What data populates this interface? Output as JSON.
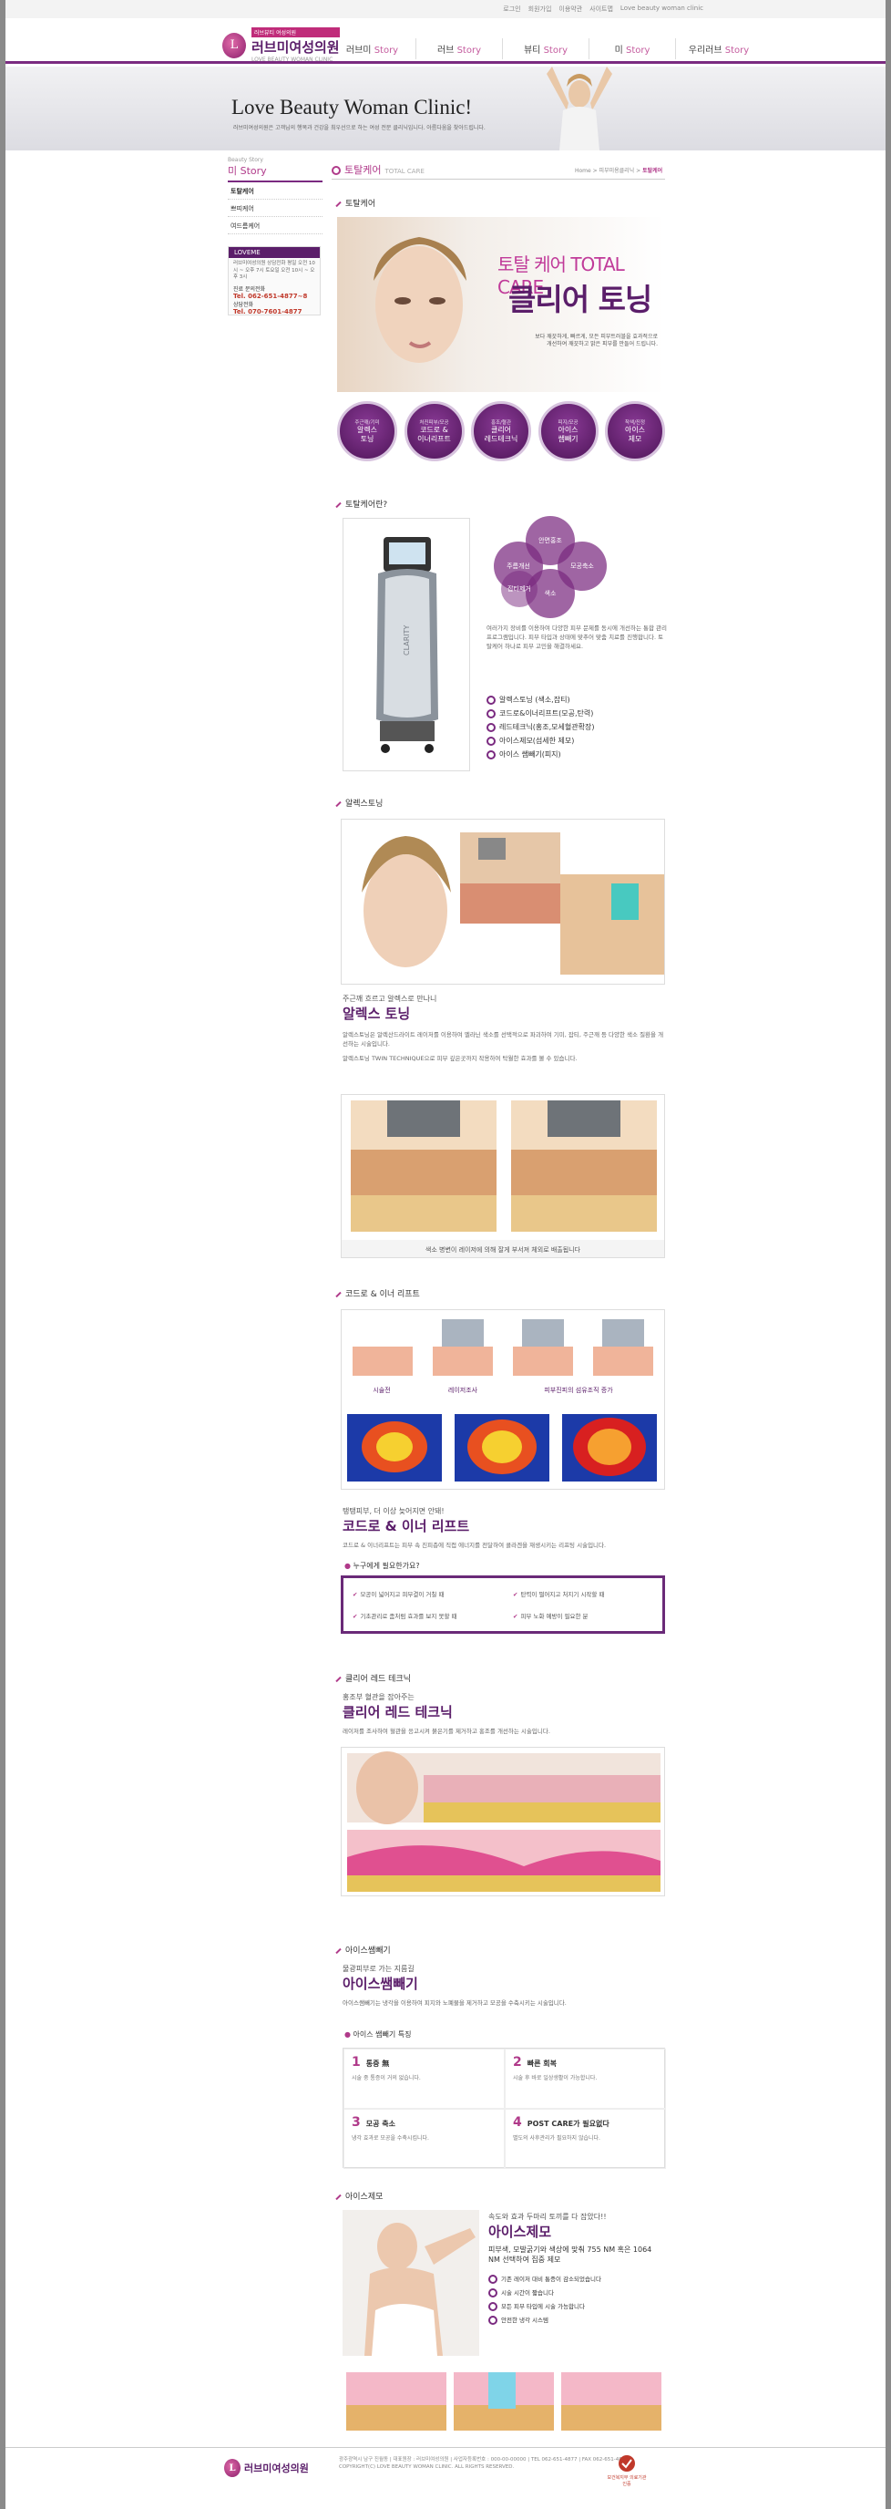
{
  "topbar": {
    "links": [
      "로그인",
      "회원가입",
      "이용약관",
      "사이트맵",
      "Love beauty woman clinic"
    ]
  },
  "header": {
    "logo_tag": "러브뷰티 여성의원",
    "logo_name": "러브미여성의원",
    "logo_en": "LOVE BEAUTY WOMAN CLINIC",
    "nav": [
      {
        "ko": "러브미",
        "en": "Story"
      },
      {
        "ko": "러브",
        "en": "Story"
      },
      {
        "ko": "뷰티",
        "en": "Story"
      },
      {
        "ko": "미",
        "en": "Story"
      },
      {
        "ko": "우리러브",
        "en": "Story"
      }
    ]
  },
  "banner": {
    "title": "Love Beauty Woman Clinic!",
    "subtitle": "러브미여성의원은 고객님의 행복과 건강을 최우선으로 하는 여성 전문 클리닉입니다. 아름다움을 찾아드립니다."
  },
  "sidebar": {
    "top": "Beauty Story",
    "title": "미 Story",
    "items": [
      "토탈케어",
      "쁘띠케어",
      "여드름케어"
    ],
    "cs": {
      "head": "LOVEME",
      "text": "러브미여성의원 상담전화 평일 오전 10시 ~ 오후 7시 토요일 오전 10시 ~ 오후 3시",
      "lbl1": "진료 문의전화",
      "tel1": "Tel. 062-651-4877~8",
      "lbl2": "상담전화",
      "tel2": "Tel. 070-7601-4877"
    }
  },
  "content": {
    "title": "토탈케어",
    "title_en": "TOTAL CARE",
    "breadcrumb_prefix": "Home > 피부미용클리닉 >",
    "breadcrumb_current": "토탈케어",
    "sec1": "토탈케어",
    "hero": {
      "t1": "토탈 케어 TOTAL CARE",
      "t2": "클리어 토닝",
      "desc": "보다 깨끗하게, 빠르게, 모든 피부트러블을 효과적으로 개선하여 깨끗하고 맑은 피부를 만들어 드립니다."
    },
    "circles": [
      {
        "sub": "주근깨/기미",
        "name": "알렉스\n토닝"
      },
      {
        "sub": "처진피부/모공",
        "name": "코드로 &\n이너리프트"
      },
      {
        "sub": "홍조/혈관",
        "name": "클리어\n레드테크닉"
      },
      {
        "sub": "피지/모공",
        "name": "아이스\n쌤빼기"
      },
      {
        "sub": "착색/진정",
        "name": "아이스\n제모"
      }
    ],
    "sec2": "토탈케어란?",
    "device_label": "CLARITY",
    "petals": [
      "안면홍조",
      "주름개선",
      "색소",
      "모공축소",
      "잡티제거"
    ],
    "info": "여러가지 장비를 이용하여 다양한 피부 문제를 동시에 개선하는 통합 관리 프로그램입니다. 피부 타입과 상태에 맞추어 맞춤 치료를 진행합니다. 토탈케어 하나로 피부 고민을 해결하세요.",
    "checks": [
      "알렉스토닝 (색소,잡티)",
      "코드로&이너리프트(모공,탄력)",
      "레드테크닉(홍조,모세혈관확장)",
      "아이스제모(섬세한 제모)",
      "아이스 쌤빼기(피지)"
    ],
    "sec3": "알렉스토닝",
    "alex": {
      "small": "주근깨 흐르고 알렉스로 만나니",
      "big": "알렉스 토닝",
      "p1": "알렉스토닝은 알렉산드라이트 레이저를 이용하여 멜라닌 색소를 선택적으로 파괴하여 기미, 잡티, 주근깨 등 다양한 색소 질환을 개선하는 시술입니다.",
      "p2": "알렉스토닝 TWIN TECHNIQUE으로 피부 깊은곳까지 작용하여 탁월한 효과를 볼 수 있습니다.",
      "caption": "색소 병변이 레이저에 의해 잘게 부서져 체외로 배출됩니다"
    },
    "sec4": "코드로 & 이너 리프트",
    "codero": {
      "labels": [
        "시술전",
        "레이저조사",
        "피부진피의 섬유조직 증가"
      ],
      "small": "탱탱피부, 더 이상 늦어지면 안돼!",
      "big": "코드로 & 이너 리프트",
      "p1": "코드로 & 이너리프트는 피부 속 진피층에 직접 에너지를 전달하여 콜라겐을 재생시키는 리프팅 시술입니다.",
      "q_title": "누구에게 필요한가요?",
      "q": [
        "모공이 넓어지고 피부결이 거칠 때",
        "탄력이 떨어지고 처지기 시작할 때",
        "기초관리로 좀처럼 효과를 보지 못할 때",
        "피부 노화 예방이 필요한 분"
      ]
    },
    "sec5": "클리어 레드 테크닉",
    "red": {
      "small": "홍조부 혈관을 잡아주는",
      "big": "클리어 레드 테크닉",
      "p1": "레이저를 조사하여 혈관을 응고시켜 붉은기를 제거하고 홍조를 개선하는 시술입니다."
    },
    "sec6": "아이스쌤빼기",
    "ice": {
      "small": "물광피부로 가는 지름길",
      "big": "아이스쌤빼기",
      "p1": "아이스쌤빼기는 냉각을 이용하여 피지와 노폐물을 제거하고 모공을 수축시키는 시술입니다.",
      "tips_title": "아이스 쌤빼기 특징",
      "tips": [
        {
          "n": "1",
          "h": "통증 無",
          "d": "시술 중 통증이 거의 없습니다."
        },
        {
          "n": "2",
          "h": "빠른 회복",
          "d": "시술 후 바로 일상생활이 가능합니다."
        },
        {
          "n": "3",
          "h": "모공 축소",
          "d": "냉각 효과로 모공을 수축시킵니다."
        },
        {
          "n": "4",
          "h": "POST CARE가 필요없다",
          "d": "별도의 사후관리가 필요하지 않습니다."
        }
      ]
    },
    "sec7": "아이스제모",
    "icer": {
      "small": "속도와 효과 두마리 토끼를 다 잡았다!!",
      "big": "아이스제모",
      "p1": "피부색, 모발굵기와 색상에 맞춰 755 NM 혹은 1064 NM 선택하여 집중 제모",
      "checks": [
        "기존 레이저 대비 통증이 감소되었습니다",
        "시술 시간이 짧습니다",
        "모든 피부 타입에 시술 가능합니다",
        "안전한 냉각 시스템"
      ]
    }
  },
  "footer": {
    "logo": "러브미여성의원",
    "addr": "광주광역시 남구 진월동 | 대표원장 : 러브미여성의원 | 사업자등록번호 : 000-00-00000 | TEL 062-651-4877 | FAX 062-651-4878\nCOPYRIGHT(C) LOVE BEAUTY WOMAN CLINIC. ALL RIGHTS RESERVED.",
    "mark": "보건복지부 의료기관인증"
  },
  "colors": {
    "brand": "#5b1e6a",
    "accent": "#b03a8a"
  }
}
